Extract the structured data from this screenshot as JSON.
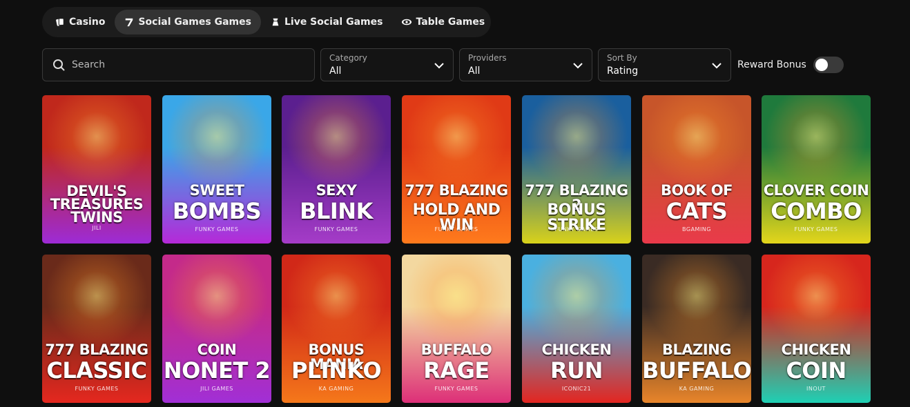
{
  "tabs": [
    {
      "label": "Casino",
      "icon": "cards-icon"
    },
    {
      "label": "Social Games Games",
      "icon": "seven-icon",
      "active": true
    },
    {
      "label": "Live Social Games",
      "icon": "dealer-icon"
    },
    {
      "label": "Table Games",
      "icon": "chip-icon"
    }
  ],
  "search": {
    "placeholder": "Search"
  },
  "filters": {
    "category": {
      "label": "Category",
      "value": "All"
    },
    "providers": {
      "label": "Providers",
      "value": "All"
    },
    "sort": {
      "label": "Sort By",
      "value": "Rating"
    }
  },
  "reward_bonus": {
    "label": "Reward Bonus",
    "enabled": false
  },
  "games": [
    {
      "line1": "DEVIL'S",
      "line2": "TREASURES",
      "line3": "TWINS",
      "provider": "JILI",
      "bg_top": "#c0281c",
      "bg_bottom": "#9d2bd6"
    },
    {
      "line1": "SWEET",
      "line2": "BOMBS",
      "provider": "FUNKY GAMES",
      "bg_top": "#3aa7e8",
      "bg_bottom": "#b529d8"
    },
    {
      "line1": "SEXY",
      "line2": "BLINK",
      "provider": "FUNKY GAMES",
      "bg_top": "#5b1f8f",
      "bg_bottom": "#a53cc8"
    },
    {
      "line1": "777 BLAZING",
      "line2": "HOLD AND WIN",
      "provider": "FUNKY GAMES",
      "bg_top": "#e03a16",
      "bg_bottom": "#ff7a1c"
    },
    {
      "line1": "777 BLAZING 2",
      "line2": "BONUS STRIKE",
      "provider": "FUNKY GAMES",
      "bg_top": "#1a5f9e",
      "bg_bottom": "#d9d21a"
    },
    {
      "line1": "BOOK OF",
      "line2": "CATS",
      "provider": "BGAMING",
      "bg_top": "#c7552a",
      "bg_bottom": "#e93a4a"
    },
    {
      "line1": "CLOVER COIN",
      "line2": "COMBO",
      "provider": "FUNKY GAMES",
      "bg_top": "#1f7a3c",
      "bg_bottom": "#e3d61b"
    },
    {
      "line1": "777 BLAZING",
      "line2": "CLASSIC",
      "provider": "FUNKY GAMES",
      "bg_top": "#6a2a1a",
      "bg_bottom": "#e5281f"
    },
    {
      "line1": "COIN",
      "line2": "NONET 2",
      "provider": "JILI GAMES",
      "bg_top": "#c42a8a",
      "bg_bottom": "#a12fd6"
    },
    {
      "line1": "BONUS MANIA",
      "line2": "PLINKO",
      "provider": "KA GAMING",
      "bg_top": "#d12818",
      "bg_bottom": "#f5781a"
    },
    {
      "line1": "BUFFALO",
      "line2": "RAGE",
      "provider": "FUNKY GAMES",
      "bg_top": "#f3d8a0",
      "bg_bottom": "#dd2f78"
    },
    {
      "line1": "CHICKEN",
      "line2": "RUN",
      "provider": "ICONIC21",
      "bg_top": "#4ab0e0",
      "bg_bottom": "#e32620"
    },
    {
      "line1": "BLAZING",
      "line2": "BUFFALO",
      "provider": "KA GAMING",
      "bg_top": "#3a2b24",
      "bg_bottom": "#e8852a"
    },
    {
      "line1": "CHICKEN",
      "line2": "COIN",
      "provider": "INOUT",
      "bg_top": "#d7261d",
      "bg_bottom": "#1ed0b4"
    }
  ]
}
